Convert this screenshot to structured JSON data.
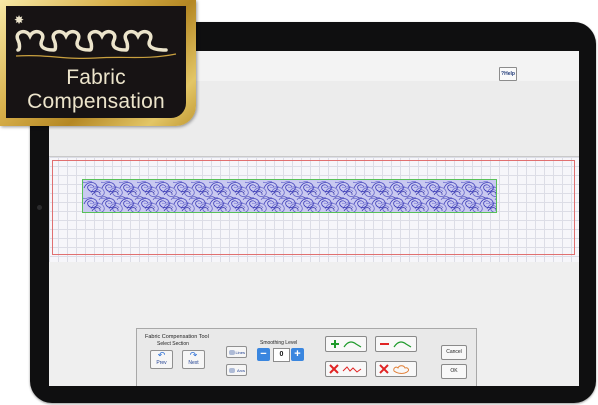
{
  "badge": {
    "title_line1": "Fabric",
    "title_line2": "Compensation"
  },
  "toolbar": {
    "help_label": "?Help"
  },
  "panel": {
    "title": "Fabric Compensation Tool",
    "select_section_label": "Select Section",
    "prev_label": "Prev",
    "next_label": "Next",
    "lines_label": "Lines",
    "arcs_label": "Arcs",
    "smoothing_label": "Smoothing Level",
    "smoothing_value": "0",
    "cancel_label": "Cancel",
    "ok_label": "OK"
  },
  "colors": {
    "add_green": "#1e9a2b",
    "remove_red": "#e02424",
    "accent_blue": "#3a86df",
    "gold": "#c9a03f"
  },
  "icons": {
    "add_segment": "plus-curve-icon",
    "remove_segment": "minus-curve-icon",
    "delete_points": "x-zigzag-icon",
    "delete_area": "x-cloud-icon"
  }
}
